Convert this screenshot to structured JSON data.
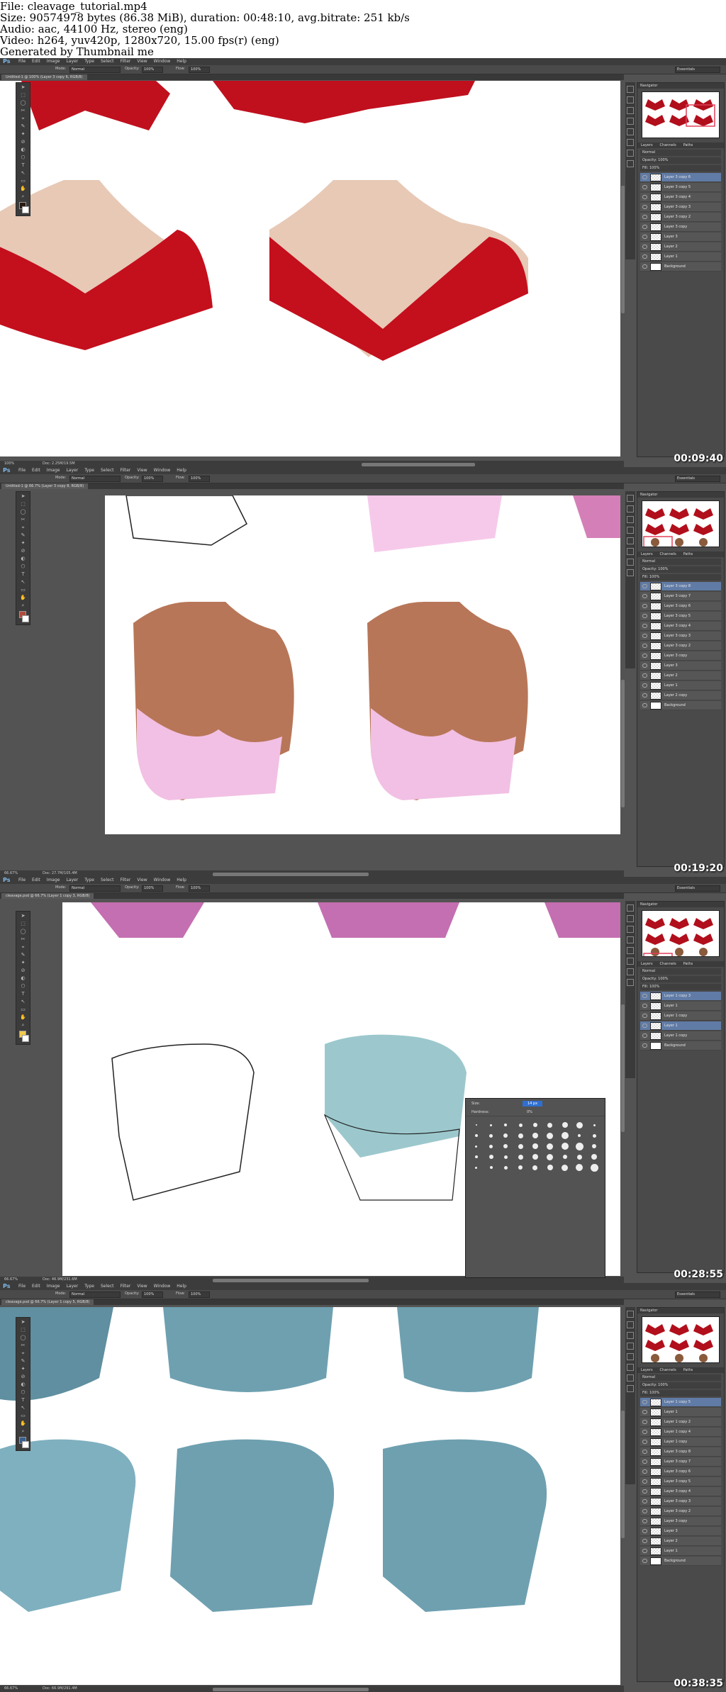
{
  "header": {
    "file": "File: cleavage_tutorial.mp4",
    "size": "Size: 90574978 bytes (86.38 MiB), duration: 00:48:10, avg.bitrate: 251 kb/s",
    "audio": "Audio: aac, 44100 Hz, stereo (eng)",
    "video": "Video: h264, yuv420p, 1280x720, 15.00 fps(r) (eng)",
    "generator": "Generated by Thumbnail me"
  },
  "app": {
    "logo": "Ps",
    "menus": [
      "File",
      "Edit",
      "Image",
      "Layer",
      "Type",
      "Select",
      "Filter",
      "View",
      "Window",
      "Help"
    ],
    "mode_label": "Mode:",
    "mode_value": "Normal",
    "opacity_label": "Opacity:",
    "opacity_value": "100%",
    "flow_label": "Flow:",
    "flow_value": "100%",
    "workspace": "Essentials",
    "panel_tab": "Navigator",
    "layers_tabs": [
      "Layers",
      "Channels",
      "Paths"
    ],
    "blend": "Normal",
    "opacity_panel": "Opacity: 100%",
    "fill_panel": "Fill: 100%"
  },
  "frames": [
    {
      "timestamp": "00:09:40",
      "doc_tab": "Untitled-1 @ 100% (Layer 3 copy 6, RGB/8)",
      "zoom": "100%",
      "doc_info": "Doc: 2.25M/19.5M",
      "fg_color": "#2a1a12",
      "layers": [
        "Layer 3 copy 6",
        "Layer 3 copy 5",
        "Layer 3 copy 4",
        "Layer 3 copy 3",
        "Layer 3 copy 2",
        "Layer 3 copy",
        "Layer 3",
        "Layer 2",
        "Layer 1",
        "Background"
      ]
    },
    {
      "timestamp": "00:19:20",
      "doc_tab": "Untitled-1 @ 66.7% (Layer 3 copy 8, RGB/8)",
      "zoom": "66.67%",
      "doc_info": "Doc: 27.7M/105.4M",
      "fg_color": "#b04b3a",
      "layers": [
        "Layer 3 copy 8",
        "Layer 3 copy 7",
        "Layer 3 copy 6",
        "Layer 3 copy 5",
        "Layer 3 copy 4",
        "Layer 3 copy 3",
        "Layer 3 copy 2",
        "Layer 3 copy",
        "Layer 3",
        "Layer 2",
        "Layer 1",
        "Layer 2 copy",
        "Background"
      ]
    },
    {
      "timestamp": "00:28:55",
      "doc_tab": "cleavage.psd @ 66.7% (Layer 1 copy 3, RGB/8)",
      "zoom": "66.67%",
      "doc_info": "Doc: 46.9M/231.6M",
      "fg_color": "#f2c94c",
      "brush_size_label": "Size:",
      "brush_size": "14 px",
      "brush_hardness_label": "Hardness:",
      "brush_hardness": "0%",
      "layers": [
        "Layer 1 copy 3",
        "Layer 1",
        "Layer 1 copy",
        "Layer 1",
        "Layer 1 copy",
        "Background"
      ]
    },
    {
      "timestamp": "00:38:35",
      "doc_tab": "cleavage.psd @ 66.7% (Layer 1 copy 5, RGB/8)",
      "zoom": "66.67%",
      "doc_info": "Doc: 66.9M/291.4M",
      "fg_color": "#3a5f8f",
      "layers": [
        "Layer 1 copy 5",
        "Layer 1",
        "Layer 1 copy 2",
        "Layer 1 copy 4",
        "Layer 1 copy",
        "Layer 3 copy 8",
        "Layer 3 copy 7",
        "Layer 3 copy 6",
        "Layer 3 copy 5",
        "Layer 3 copy 4",
        "Layer 3 copy 3",
        "Layer 3 copy 2",
        "Layer 3 copy",
        "Layer 3",
        "Layer 2",
        "Layer 1",
        "Background"
      ]
    }
  ]
}
